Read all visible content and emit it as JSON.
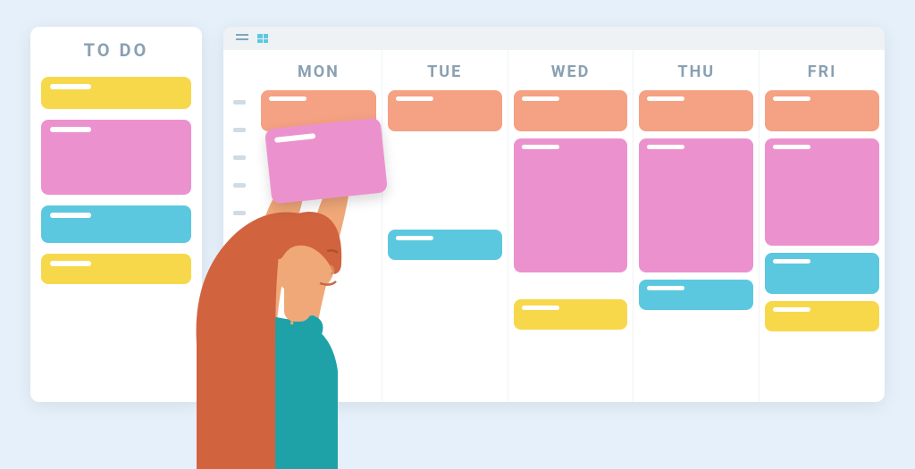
{
  "todo": {
    "title": "TO DO",
    "items": [
      {
        "color": "yellow",
        "height": 36
      },
      {
        "color": "pink",
        "height": 84
      },
      {
        "color": "cyan",
        "height": 42
      },
      {
        "color": "yellow",
        "height": 34
      }
    ]
  },
  "calendar": {
    "days": [
      "MON",
      "TUE",
      "WED",
      "THU",
      "FRI"
    ]
  },
  "colors": {
    "yellow": "#f7d84b",
    "pink": "#eb92ce",
    "cyan": "#5cc8df",
    "orange": "#f5a183",
    "textMuted": "#8aa0b3"
  }
}
